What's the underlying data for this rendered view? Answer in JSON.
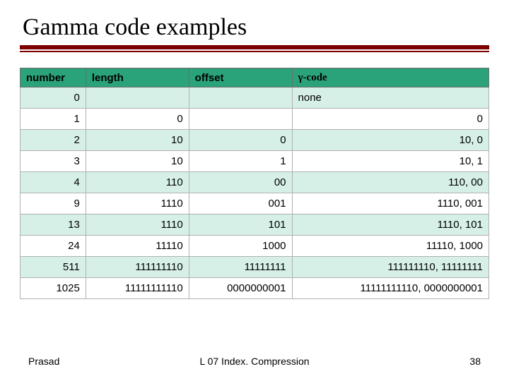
{
  "title": "Gamma code examples",
  "headers": {
    "number": "number",
    "length": "length",
    "offset": "offset",
    "code": "γ-code"
  },
  "rows": [
    {
      "number": "0",
      "length": "",
      "offset": "",
      "code": "none"
    },
    {
      "number": "1",
      "length": "0",
      "offset": "",
      "code": "0"
    },
    {
      "number": "2",
      "length": "10",
      "offset": "0",
      "code": "10, 0"
    },
    {
      "number": "3",
      "length": "10",
      "offset": "1",
      "code": "10, 1"
    },
    {
      "number": "4",
      "length": "110",
      "offset": "00",
      "code": "110, 00"
    },
    {
      "number": "9",
      "length": "1110",
      "offset": "001",
      "code": "1110, 001"
    },
    {
      "number": "13",
      "length": "1110",
      "offset": "101",
      "code": "1110, 101"
    },
    {
      "number": "24",
      "length": "11110",
      "offset": "1000",
      "code": "11110, 1000"
    },
    {
      "number": "511",
      "length": "111111110",
      "offset": "11111111",
      "code": "111111110, 11111111"
    },
    {
      "number": "1025",
      "length": "11111111110",
      "offset": "0000000001",
      "code": "11111111110, 0000000001"
    }
  ],
  "footer": {
    "left": "Prasad",
    "center": "L 07 Index. Compression",
    "right": "38"
  }
}
